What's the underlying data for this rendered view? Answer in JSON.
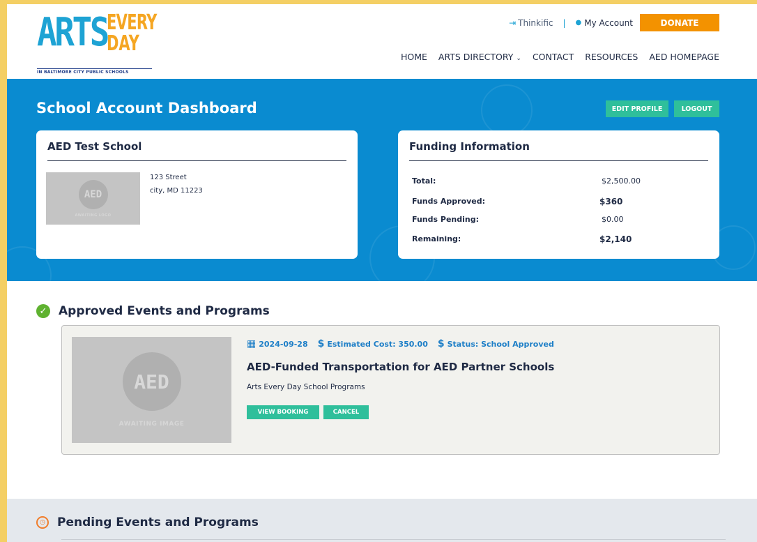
{
  "header": {
    "logo": {
      "line1": "ARTS",
      "line2": "EVERY",
      "line3": "DAY",
      "tagline": "IN BALTIMORE CITY PUBLIC SCHOOLS"
    },
    "util": {
      "thinkific": "Thinkific",
      "separator": "|",
      "account": "My Account",
      "donate": "DONATE"
    },
    "nav": [
      "HOME",
      "ARTS DIRECTORY",
      "CONTACT",
      "RESOURCES",
      "AED HOMEPAGE"
    ]
  },
  "dashboard": {
    "title": "School Account Dashboard",
    "edit_profile": "EDIT PROFILE",
    "logout": "LOGOUT",
    "school": {
      "name": "AED Test School",
      "logo_text": "AED",
      "logo_placeholder": "AWAITING LOGO",
      "address_line1": "123 Street",
      "address_line2": "city, MD 11223"
    },
    "funding": {
      "title": "Funding Information",
      "rows": [
        {
          "label": "Total:",
          "value": "$2,500.00"
        },
        {
          "label": "Funds Approved:",
          "value": "$360"
        },
        {
          "label": "Funds Pending:",
          "value": "$0.00"
        },
        {
          "label": "Remaining:",
          "value": "$2,140"
        }
      ]
    }
  },
  "approved": {
    "heading": "Approved Events and Programs",
    "event": {
      "image_text": "AED",
      "image_placeholder": "AWAITING IMAGE",
      "date": "2024-09-28",
      "estimated_cost": "Estimated Cost: 350.00",
      "status": "Status: School Approved",
      "title": "AED-Funded Transportation for AED Partner Schools",
      "subtitle": "Arts Every Day School Programs",
      "view_booking": "VIEW BOOKING",
      "cancel": "CANCEL"
    }
  },
  "pending": {
    "heading": "Pending Events and Programs"
  },
  "colors": {
    "brand_blue": "#0a8bd0",
    "accent_orange": "#f39200",
    "action_green": "#2fbf9b",
    "frame_yellow": "#f4cf64"
  }
}
